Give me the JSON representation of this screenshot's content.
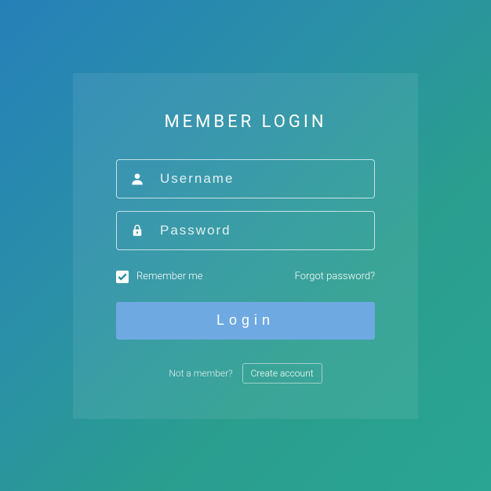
{
  "title": "MEMBER LOGIN",
  "username": {
    "placeholder": "Username",
    "value": ""
  },
  "password": {
    "placeholder": "Password",
    "value": ""
  },
  "remember": {
    "label": "Remember me",
    "checked": true
  },
  "forgot_label": "Forgot password?",
  "login_label": "Login",
  "footer": {
    "not_member": "Not a member?",
    "create_account": "Create account"
  }
}
